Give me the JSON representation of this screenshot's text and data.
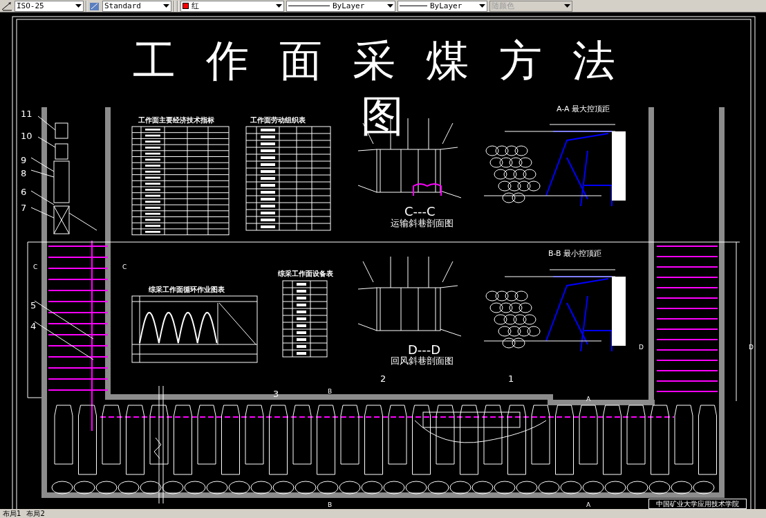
{
  "toolbar": {
    "dim_style": "ISO-25",
    "text_style": "Standard",
    "color": {
      "label": "红"
    },
    "linetype": "ByLayer",
    "lineweight": "ByLayer",
    "plot_style": {
      "value": "随颜色",
      "disabled": true
    }
  },
  "drawing": {
    "title_lines": [
      "工作面采煤方法",
      "图"
    ],
    "tables": [
      {
        "title": "工作面主要经济技术指标"
      },
      {
        "title": "工作面劳动组织表"
      },
      {
        "title": "综采工作面循环作业图表"
      },
      {
        "title": "综采工作面设备表"
      }
    ],
    "section_titles": [
      {
        "label": "C---C",
        "caption": "运输斜巷剖面图"
      },
      {
        "label": "D---D",
        "caption": "回风斜巷剖面图"
      },
      {
        "label": "A-A  最大控顶距"
      },
      {
        "label": "B-B  最小控顶距"
      }
    ],
    "callouts": [
      "11",
      "10",
      "9",
      "8",
      "6",
      "7",
      "5",
      "4",
      "3",
      "2",
      "1"
    ],
    "section_marks": [
      "C",
      "C",
      "D",
      "D",
      "B",
      "A",
      "B",
      "A"
    ],
    "title_block": "中国矿业大学应用技术学院"
  },
  "layout_tabs": [
    "布局1",
    "布局2"
  ]
}
